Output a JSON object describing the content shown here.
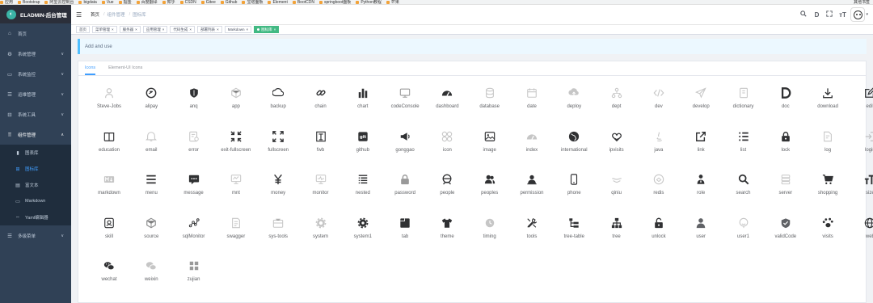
{
  "bookmarks": [
    "应用",
    "Bootstrap",
    "阿里云控制台",
    "bigdata",
    "Vue",
    "掘金",
    "百度翻译",
    "知乎",
    "CSDN",
    "Gitee",
    "Github",
    "宝塔面板",
    "Element",
    "BootCDN",
    "springboot面板",
    "Python教程",
    "芒果"
  ],
  "bookmarks_right": "其他书签",
  "sidebar": {
    "logo_text": "ELADMIN-后台管理",
    "items": [
      {
        "label": "首页",
        "icon": "home-icon",
        "glyph": "⌂",
        "arrow": ""
      },
      {
        "label": "系统管理",
        "icon": "gear-icon",
        "glyph": "⚙",
        "arrow": "∨"
      },
      {
        "label": "系统监控",
        "icon": "monitor-icon",
        "glyph": "▭",
        "arrow": "∨"
      },
      {
        "label": "运维管理",
        "icon": "ops-icon",
        "glyph": "☰",
        "arrow": "∨"
      },
      {
        "label": "系统工具",
        "icon": "toolbox-icon",
        "glyph": "⊟",
        "arrow": "∨"
      },
      {
        "label": "组件管理",
        "icon": "component-icon",
        "glyph": "⠿",
        "arrow": "∧"
      }
    ],
    "sub_items": [
      {
        "label": "图表库",
        "icon": "chart-icon",
        "glyph": "▮"
      },
      {
        "label": "图标库",
        "icon": "icons-icon",
        "glyph": "⊞"
      },
      {
        "label": "富文本",
        "icon": "richtext-icon",
        "glyph": "▤"
      },
      {
        "label": "Markdown",
        "icon": "markdown-icon",
        "glyph": "▭"
      },
      {
        "label": "Yaml编辑器",
        "icon": "yaml-icon",
        "glyph": "⇔"
      }
    ],
    "bottom_item": {
      "label": "多级菜单",
      "icon": "menu-icon",
      "glyph": "☰",
      "arrow": "∨"
    }
  },
  "header": {
    "breadcrumbs": [
      "首页",
      "组件管理",
      "图标库"
    ],
    "right_icons": [
      "search-icon",
      "doc-icon",
      "fullscreen-icon",
      "font-size-icon"
    ]
  },
  "tags": [
    "首页",
    "菜单管理",
    "服务器",
    "应用管理",
    "代码生成",
    "部署列表",
    "Markdown",
    "图标库"
  ],
  "tip": "Add and use",
  "tabs": [
    "Icons",
    "Element-UI Icons"
  ],
  "icons": [
    "Steve-Jobs",
    "alipay",
    "anq",
    "app",
    "backup",
    "chain",
    "chart",
    "codeConsole",
    "dashboard",
    "database",
    "date",
    "deploy",
    "dept",
    "dev",
    "develop",
    "dictionary",
    "doc",
    "download",
    "edit",
    "education",
    "email",
    "error",
    "exit-fullscreen",
    "fullscreen",
    "fwb",
    "github",
    "gonggao",
    "icon",
    "image",
    "index",
    "international",
    "ipvisits",
    "java",
    "link",
    "list",
    "lock",
    "log",
    "login",
    "markdown",
    "menu",
    "message",
    "mnt",
    "money",
    "monitor",
    "nested",
    "password",
    "people",
    "peoples",
    "permission",
    "phone",
    "qiniu",
    "redis",
    "role",
    "search",
    "server",
    "shopping",
    "size",
    "skill",
    "source",
    "sqlMonitor",
    "swagger",
    "sys-tools",
    "system",
    "system1",
    "tab",
    "theme",
    "timing",
    "tools",
    "tree-table",
    "tree",
    "unlock",
    "user",
    "user1",
    "validCode",
    "visits",
    "web",
    "wechat",
    "weixin",
    "zujian"
  ],
  "dim_icons": [
    "Steve-Jobs",
    "app",
    "database",
    "date",
    "deploy",
    "dept",
    "dev",
    "develop",
    "dictionary",
    "email",
    "error",
    "icon",
    "index",
    "java",
    "log",
    "login",
    "markdown",
    "mnt",
    "monitor",
    "qiniu",
    "redis",
    "server",
    "source",
    "swagger",
    "sys-tools",
    "system",
    "timing",
    "user1",
    "weixin"
  ]
}
